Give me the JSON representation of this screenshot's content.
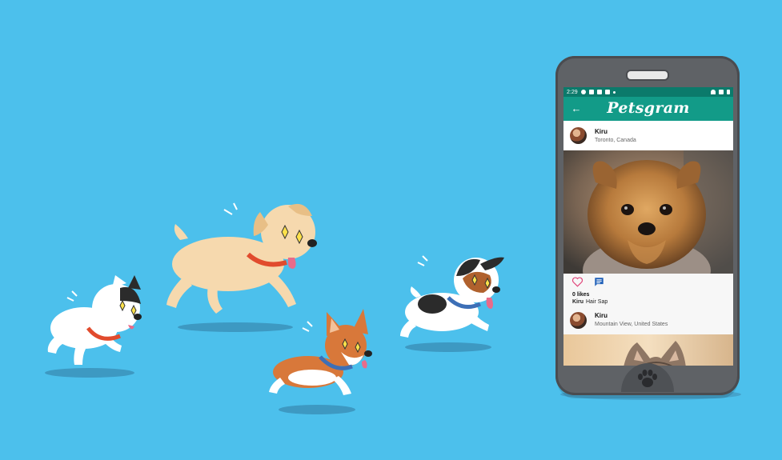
{
  "status_bar": {
    "time": "2:29"
  },
  "app_bar": {
    "title": "Petsgram",
    "back_icon": "arrow-left-icon"
  },
  "posts": [
    {
      "user": "Kiru",
      "location": "Toronto, Canada",
      "likes": "0 likes",
      "caption_user": "Kiru",
      "caption": "Hair Sap"
    },
    {
      "user": "Kiru",
      "location": "Mountain View, United States"
    }
  ],
  "icons": {
    "like": "heart-outline-icon",
    "comment": "comment-icon",
    "home": "paw-icon"
  },
  "colors": {
    "background": "#4cc0ec",
    "app_bar": "#129b88",
    "status_bar": "#0b7a6b",
    "heart": "#e0457a",
    "comment": "#1e5fb8"
  }
}
